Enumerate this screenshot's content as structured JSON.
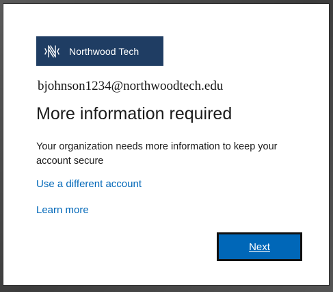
{
  "brand": {
    "name": "Northwood Tech",
    "logo_icon": "northwood-n-logo-icon",
    "logo_bg_color": "#1f3d63"
  },
  "account": {
    "email": "bjohnson1234@northwoodtech.edu"
  },
  "content": {
    "title": "More information required",
    "description": "Your organization needs more information to keep your account secure"
  },
  "links": {
    "different_account": "Use a different account",
    "learn_more": "Learn more"
  },
  "actions": {
    "next_label": "Next"
  },
  "colors": {
    "accent": "#0067b8",
    "text": "#1b1b1b"
  }
}
